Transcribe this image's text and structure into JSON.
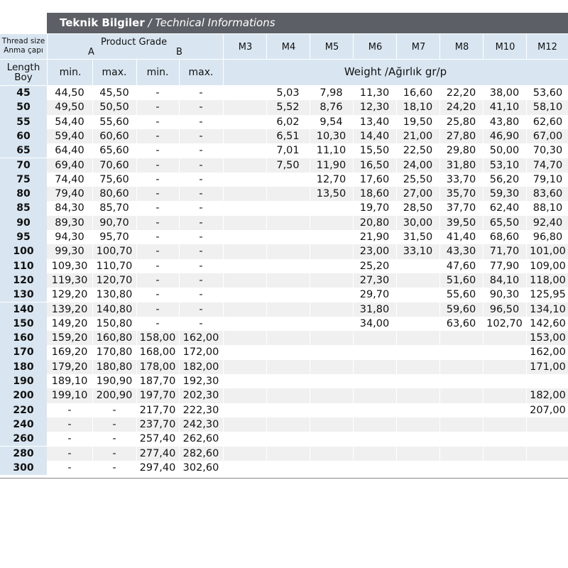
{
  "title": {
    "turkish": "Teknik Bilgiler",
    "separator": " / ",
    "english": "Technical Informations"
  },
  "header": {
    "thread_size_en": "Thread size",
    "thread_size_tr": "Anma çapı",
    "product_grade": "Product Grade",
    "grade_a": "A",
    "grade_b": "B",
    "length_en": "Length",
    "length_tr": "Boy",
    "min_a": "min.",
    "max_a": "max.",
    "min_b": "min.",
    "max_b": "max.",
    "weight_label": "Weight /Ağırlık gr/p",
    "sizes": [
      "M3",
      "M4",
      "M5",
      "M6",
      "M7",
      "M8",
      "M10",
      "M12"
    ]
  },
  "rows": [
    {
      "length": "45",
      "cells": [
        "44,50",
        "45,50",
        "-",
        "-",
        "",
        "5,03",
        "7,98",
        "11,30",
        "16,60",
        "22,20",
        "38,00",
        "53,60"
      ]
    },
    {
      "length": "50",
      "cells": [
        "49,50",
        "50,50",
        "-",
        "-",
        "",
        "5,52",
        "8,76",
        "12,30",
        "18,10",
        "24,20",
        "41,10",
        "58,10"
      ]
    },
    {
      "length": "55",
      "cells": [
        "54,40",
        "55,60",
        "-",
        "-",
        "",
        "6,02",
        "9,54",
        "13,40",
        "19,50",
        "25,80",
        "43,80",
        "62,60"
      ]
    },
    {
      "length": "60",
      "cells": [
        "59,40",
        "60,60",
        "-",
        "-",
        "",
        "6,51",
        "10,30",
        "14,40",
        "21,00",
        "27,80",
        "46,90",
        "67,00"
      ]
    },
    {
      "length": "65",
      "cells": [
        "64,40",
        "65,60",
        "-",
        "-",
        "",
        "7,01",
        "11,10",
        "15,50",
        "22,50",
        "29,80",
        "50,00",
        "70,30"
      ]
    },
    {
      "length": "70",
      "cells": [
        "69,40",
        "70,60",
        "-",
        "-",
        "",
        "7,50",
        "11,90",
        "16,50",
        "24,00",
        "31,80",
        "53,10",
        "74,70"
      ]
    },
    {
      "length": "75",
      "cells": [
        "74,40",
        "75,60",
        "-",
        "-",
        "",
        "",
        "12,70",
        "17,60",
        "25,50",
        "33,70",
        "56,20",
        "79,10"
      ]
    },
    {
      "length": "80",
      "cells": [
        "79,40",
        "80,60",
        "-",
        "-",
        "",
        "",
        "13,50",
        "18,60",
        "27,00",
        "35,70",
        "59,30",
        "83,60"
      ]
    },
    {
      "length": "85",
      "cells": [
        "84,30",
        "85,70",
        "-",
        "-",
        "",
        "",
        "",
        "19,70",
        "28,50",
        "37,70",
        "62,40",
        "88,10"
      ]
    },
    {
      "length": "90",
      "cells": [
        "89,30",
        "90,70",
        "-",
        "-",
        "",
        "",
        "",
        "20,80",
        "30,00",
        "39,50",
        "65,50",
        "92,40"
      ]
    },
    {
      "length": "95",
      "cells": [
        "94,30",
        "95,70",
        "-",
        "-",
        "",
        "",
        "",
        "21,90",
        "31,50",
        "41,40",
        "68,60",
        "96,80"
      ]
    },
    {
      "length": "100",
      "cells": [
        "99,30",
        "100,70",
        "-",
        "-",
        "",
        "",
        "",
        "23,00",
        "33,10",
        "43,30",
        "71,70",
        "101,00"
      ]
    },
    {
      "length": "110",
      "cells": [
        "109,30",
        "110,70",
        "-",
        "-",
        "",
        "",
        "",
        "25,20",
        "",
        "47,60",
        "77,90",
        "109,00"
      ]
    },
    {
      "length": "120",
      "cells": [
        "119,30",
        "120,70",
        "-",
        "-",
        "",
        "",
        "",
        "27,30",
        "",
        "51,60",
        "84,10",
        "118,00"
      ]
    },
    {
      "length": "130",
      "cells": [
        "129,20",
        "130,80",
        "-",
        "-",
        "",
        "",
        "",
        "29,70",
        "",
        "55,60",
        "90,30",
        "125,95"
      ]
    },
    {
      "length": "140",
      "cells": [
        "139,20",
        "140,80",
        "-",
        "-",
        "",
        "",
        "",
        "31,80",
        "",
        "59,60",
        "96,50",
        "134,10"
      ]
    },
    {
      "length": "150",
      "cells": [
        "149,20",
        "150,80",
        "-",
        "-",
        "",
        "",
        "",
        "34,00",
        "",
        "63,60",
        "102,70",
        "142,60"
      ]
    },
    {
      "length": "160",
      "cells": [
        "159,20",
        "160,80",
        "158,00",
        "162,00",
        "",
        "",
        "",
        "",
        "",
        "",
        "",
        "153,00"
      ]
    },
    {
      "length": "170",
      "cells": [
        "169,20",
        "170,80",
        "168,00",
        "172,00",
        "",
        "",
        "",
        "",
        "",
        "",
        "",
        "162,00"
      ]
    },
    {
      "length": "180",
      "cells": [
        "179,20",
        "180,80",
        "178,00",
        "182,00",
        "",
        "",
        "",
        "",
        "",
        "",
        "",
        "171,00"
      ]
    },
    {
      "length": "190",
      "cells": [
        "189,10",
        "190,90",
        "187,70",
        "192,30",
        "",
        "",
        "",
        "",
        "",
        "",
        "",
        ""
      ]
    },
    {
      "length": "200",
      "cells": [
        "199,10",
        "200,90",
        "197,70",
        "202,30",
        "",
        "",
        "",
        "",
        "",
        "",
        "",
        "182,00"
      ]
    },
    {
      "length": "220",
      "cells": [
        "-",
        "-",
        "217,70",
        "222,30",
        "",
        "",
        "",
        "",
        "",
        "",
        "",
        "207,00"
      ]
    },
    {
      "length": "240",
      "cells": [
        "-",
        "-",
        "237,70",
        "242,30",
        "",
        "",
        "",
        "",
        "",
        "",
        "",
        ""
      ]
    },
    {
      "length": "260",
      "cells": [
        "-",
        "-",
        "257,40",
        "262,60",
        "",
        "",
        "",
        "",
        "",
        "",
        "",
        ""
      ]
    },
    {
      "length": "280",
      "cells": [
        "-",
        "-",
        "277,40",
        "282,60",
        "",
        "",
        "",
        "",
        "",
        "",
        "",
        ""
      ]
    },
    {
      "length": "300",
      "cells": [
        "-",
        "-",
        "297,40",
        "302,60",
        "",
        "",
        "",
        "",
        "",
        "",
        "",
        ""
      ]
    }
  ]
}
